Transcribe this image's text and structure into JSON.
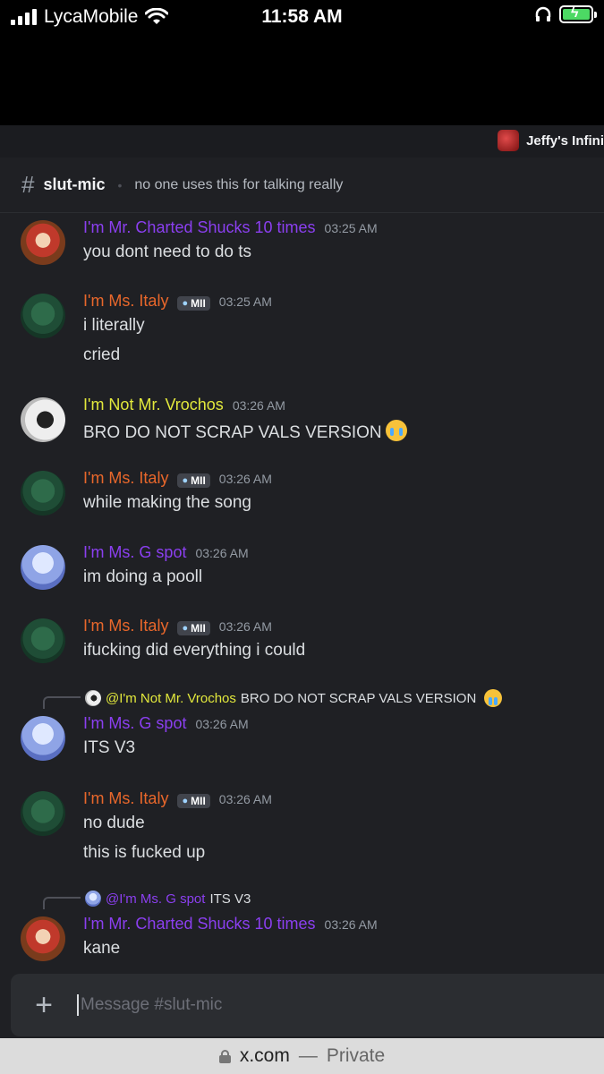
{
  "status_bar": {
    "carrier": "LycaMobile",
    "time": "11:58 AM",
    "battery_state": "charging",
    "accent_battery": "#4cd964"
  },
  "server": {
    "name": "Jeffy's Infini"
  },
  "channel": {
    "name": "slut-mic",
    "topic": "no one uses this for talking really"
  },
  "colors": {
    "background": "#1f2024",
    "purple_role": "#8b3ff0",
    "orange_role": "#e8672b",
    "yellow_role": "#e2e83c",
    "text": "#dbdee1",
    "timestamp": "#949ba4"
  },
  "messages": [
    {
      "author": "I'm Mr. Charted Shucks 10 times",
      "time": "03:25 AM",
      "lines": [
        "you dont need to do ts"
      ]
    },
    {
      "author": "I'm Ms. Italy",
      "badge": "MII",
      "time": "03:25 AM",
      "lines": [
        "i literally",
        "cried"
      ]
    },
    {
      "author": "I'm Not Mr. Vrochos",
      "time": "03:26 AM",
      "lines": [
        "BRO DO NOT SCRAP VALS VERSION"
      ],
      "emoji": "sob"
    },
    {
      "author": "I'm Ms. Italy",
      "badge": "MII",
      "time": "03:26 AM",
      "lines": [
        "while making the song"
      ]
    },
    {
      "author": "I'm Ms. G spot",
      "time": "03:26 AM",
      "lines": [
        "im doing a pooll"
      ]
    },
    {
      "author": "I'm Ms. Italy",
      "badge": "MII",
      "time": "03:26 AM",
      "lines": [
        "ifucking did everything i could"
      ]
    },
    {
      "reply": {
        "to": "@I'm Not Mr. Vrochos",
        "text": "BRO DO NOT SCRAP VALS VERSION",
        "emoji": "sob"
      },
      "author": "I'm Ms. G spot",
      "time": "03:26 AM",
      "lines": [
        "ITS V3"
      ]
    },
    {
      "author": "I'm Ms. Italy",
      "badge": "MII",
      "time": "03:26 AM",
      "lines": [
        "no dude",
        "this is fucked up"
      ]
    },
    {
      "reply": {
        "to": "@I'm Ms. G spot",
        "text": "ITS V3"
      },
      "author": "I'm Mr. Charted Shucks 10 times",
      "time": "03:26 AM",
      "lines": [
        "kane"
      ]
    }
  ],
  "composer": {
    "placeholder": "Message #slut-mic"
  },
  "browser": {
    "domain": "x.com",
    "separator": "—",
    "mode": "Private"
  }
}
